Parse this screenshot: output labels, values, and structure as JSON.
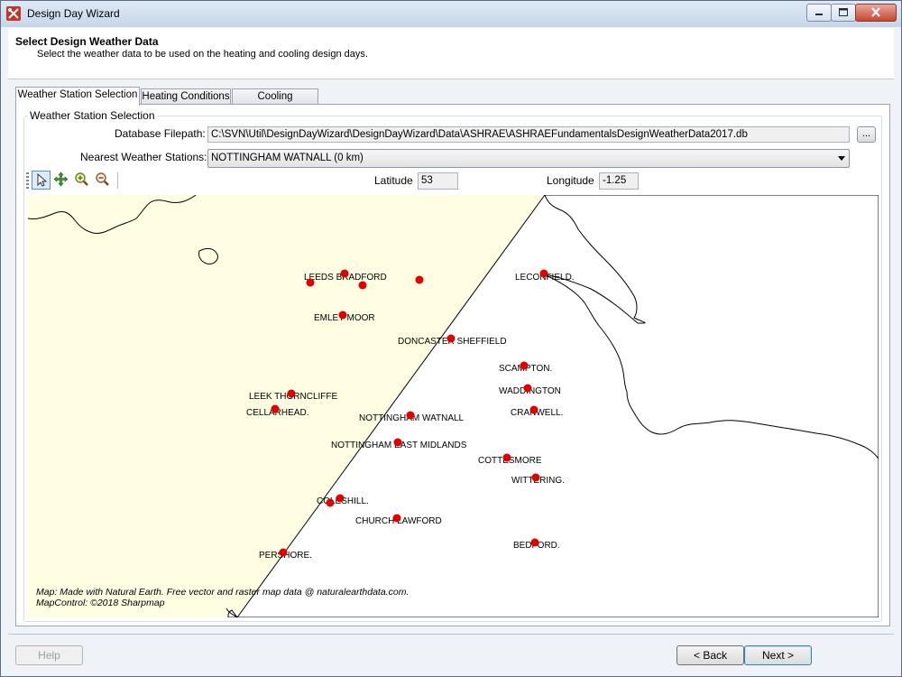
{
  "window": {
    "title": "Design Day Wizard"
  },
  "header": {
    "title": "Select Design Weather Data",
    "subtitle": "Select the weather data to be used on the heating and cooling design days."
  },
  "tabs": [
    {
      "label": "Weather Station Selection",
      "active": true
    },
    {
      "label": "Heating Conditions",
      "active": false
    },
    {
      "label": "Cooling Conditions",
      "active": false
    }
  ],
  "group": {
    "title": "Weather Station Selection"
  },
  "form": {
    "db_label": "Database Filepath:",
    "db_value": "C:\\SVN\\Util\\DesignDayWizard\\DesignDayWizard\\Data\\ASHRAE\\ASHRAEFundamentalsDesignWeatherData2017.db",
    "browse_label": "...",
    "stations_label": "Nearest Weather Stations:",
    "stations_value": "NOTTINGHAM WATNALL (0 km)",
    "lat_label": "Latitude",
    "lat_value": "53",
    "lon_label": "Longitude",
    "lon_value": "-1.25"
  },
  "toolbar": {
    "tools": [
      {
        "icon": "pointer-icon",
        "selected": true
      },
      {
        "icon": "pan-icon",
        "selected": false
      },
      {
        "icon": "zoom-in-icon",
        "selected": false
      },
      {
        "icon": "zoom-out-icon",
        "selected": false
      }
    ]
  },
  "map": {
    "land_color": "#fffee3",
    "coast_color": "#000000",
    "station_color": "#e00000",
    "stations": [
      {
        "label": "LEEDS BRADFORD"
      },
      {
        "label": ""
      },
      {
        "label": ""
      },
      {
        "label": ""
      },
      {
        "label": "LECONFIELD."
      },
      {
        "label": "EMLEY MOOR"
      },
      {
        "label": "DONCASTER SHEFFIELD"
      },
      {
        "label": "SCAMPTON."
      },
      {
        "label": "WADDINGTON"
      },
      {
        "label": "LEEK THORNCLIFFE"
      },
      {
        "label": "CELLARHEAD."
      },
      {
        "label": "NOTTINGHAM WATNALL"
      },
      {
        "label": "CRANWELL."
      },
      {
        "label": "NOTTINGHAM EAST MIDLANDS"
      },
      {
        "label": "COTTESMORE"
      },
      {
        "label": "WITTERING."
      },
      {
        "label": "COLESHILL."
      },
      {
        "label": ""
      },
      {
        "label": "CHURCH LAWFORD"
      },
      {
        "label": "BEDFORD."
      },
      {
        "label": "PERSHORE."
      }
    ],
    "credit_line1": "Map: Made with Natural Earth. Free vector and raster map data @ naturalearthdata.com.",
    "credit_line2": "MapControl: ©2018 Sharpmap"
  },
  "buttons": {
    "help": "Help",
    "back": "< Back",
    "next": "Next >"
  }
}
